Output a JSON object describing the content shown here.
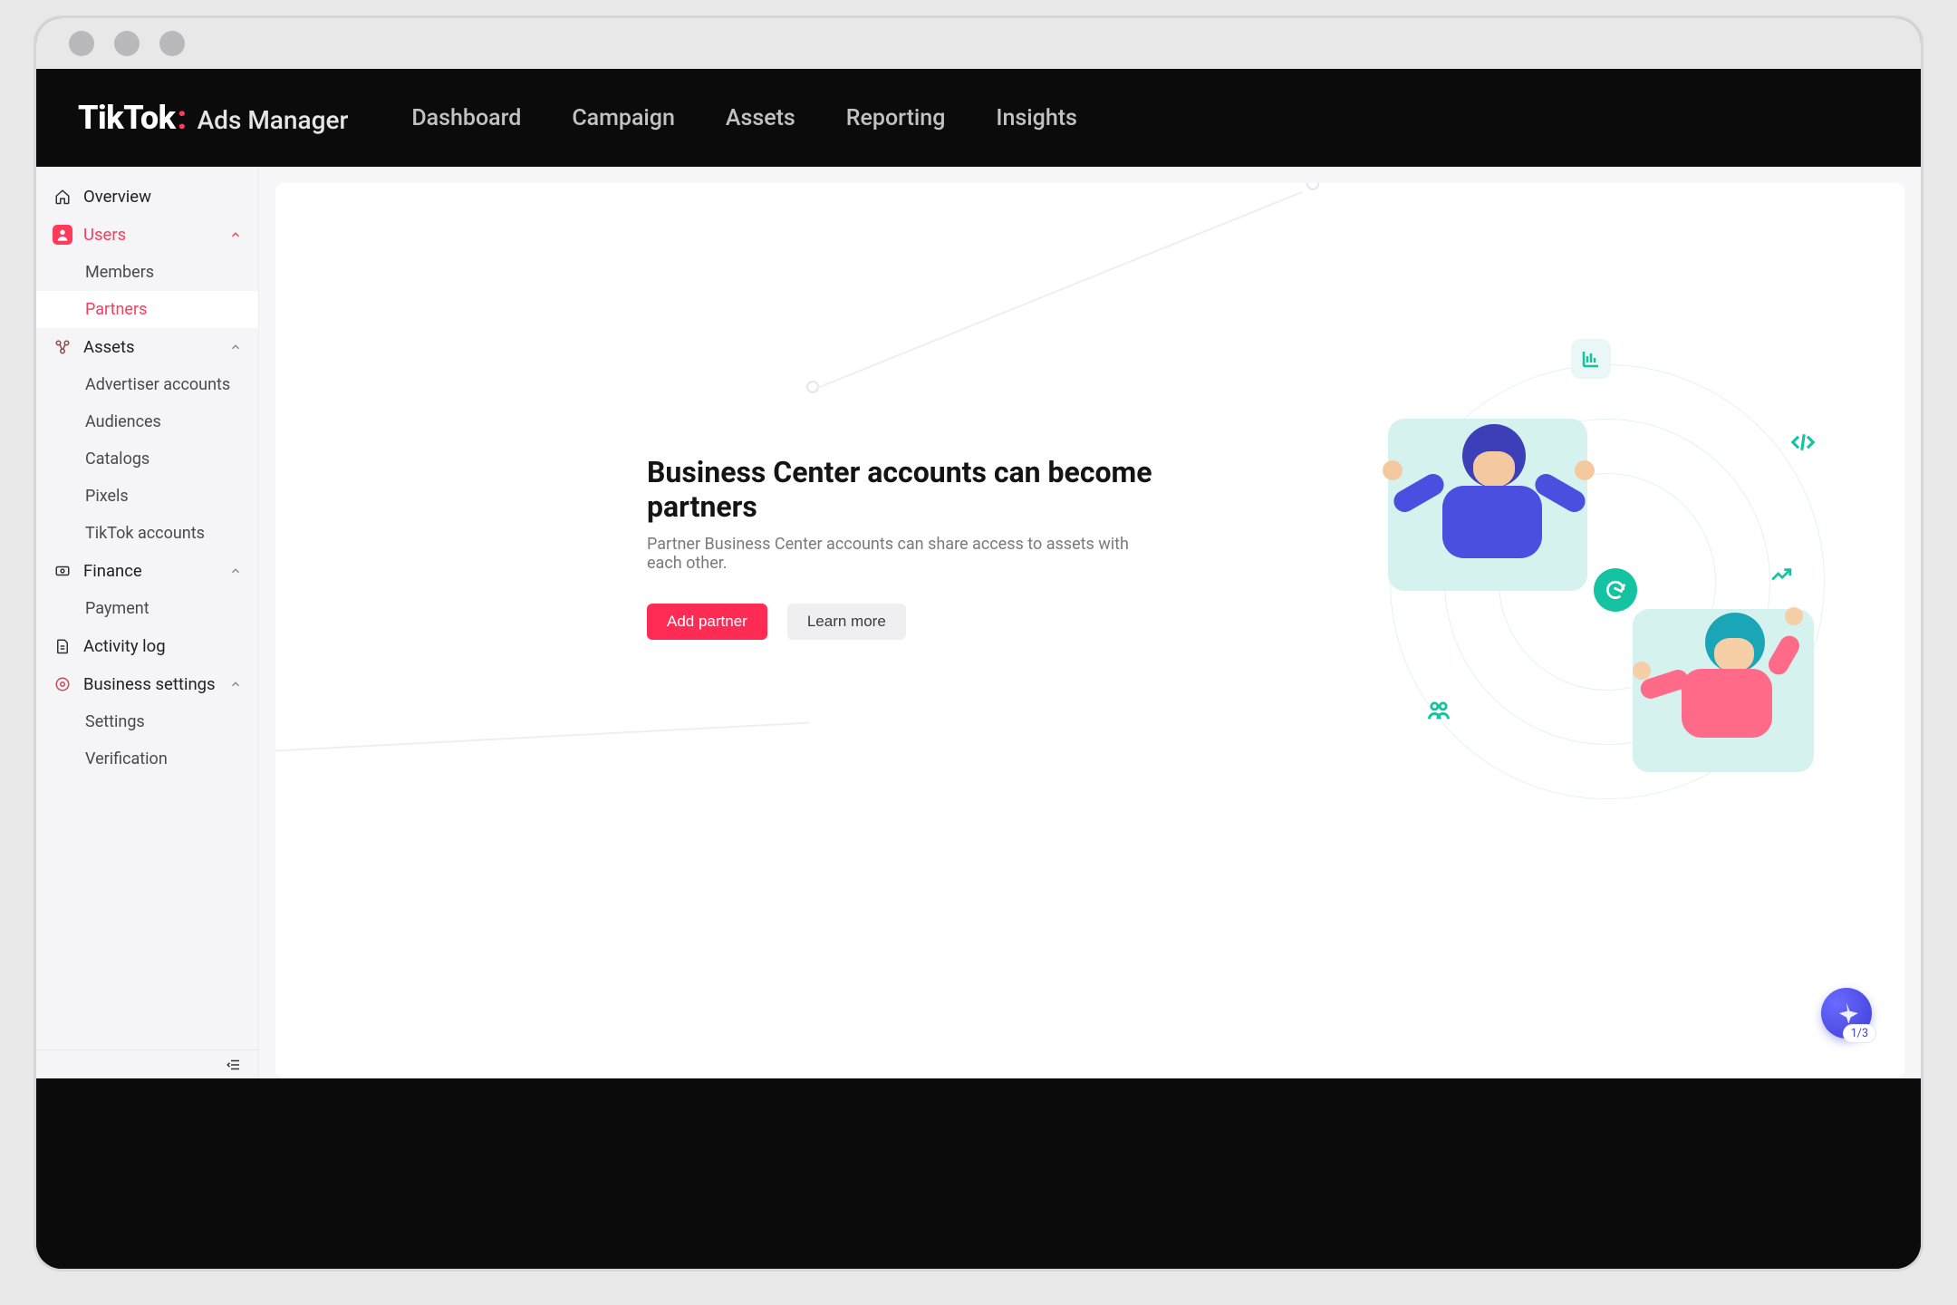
{
  "logo": {
    "brand": "TikTok",
    "sub": "Ads Manager"
  },
  "topnav": [
    "Dashboard",
    "Campaign",
    "Assets",
    "Reporting",
    "Insights"
  ],
  "sidebar": {
    "overview": "Overview",
    "users": {
      "label": "Users",
      "members": "Members",
      "partners": "Partners"
    },
    "assets": {
      "label": "Assets",
      "advertiser_accounts": "Advertiser accounts",
      "audiences": "Audiences",
      "catalogs": "Catalogs",
      "pixels": "Pixels",
      "tiktok_accounts": "TikTok accounts"
    },
    "finance": {
      "label": "Finance",
      "payment": "Payment"
    },
    "activity_log": "Activity log",
    "business_settings": {
      "label": "Business settings",
      "settings": "Settings",
      "verification": "Verification"
    }
  },
  "hero": {
    "title": "Business Center accounts can become partners",
    "subtitle": "Partner Business Center accounts can share access to assets with each other.",
    "primary": "Add partner",
    "secondary": "Learn more"
  },
  "fab_badge": "1/3"
}
